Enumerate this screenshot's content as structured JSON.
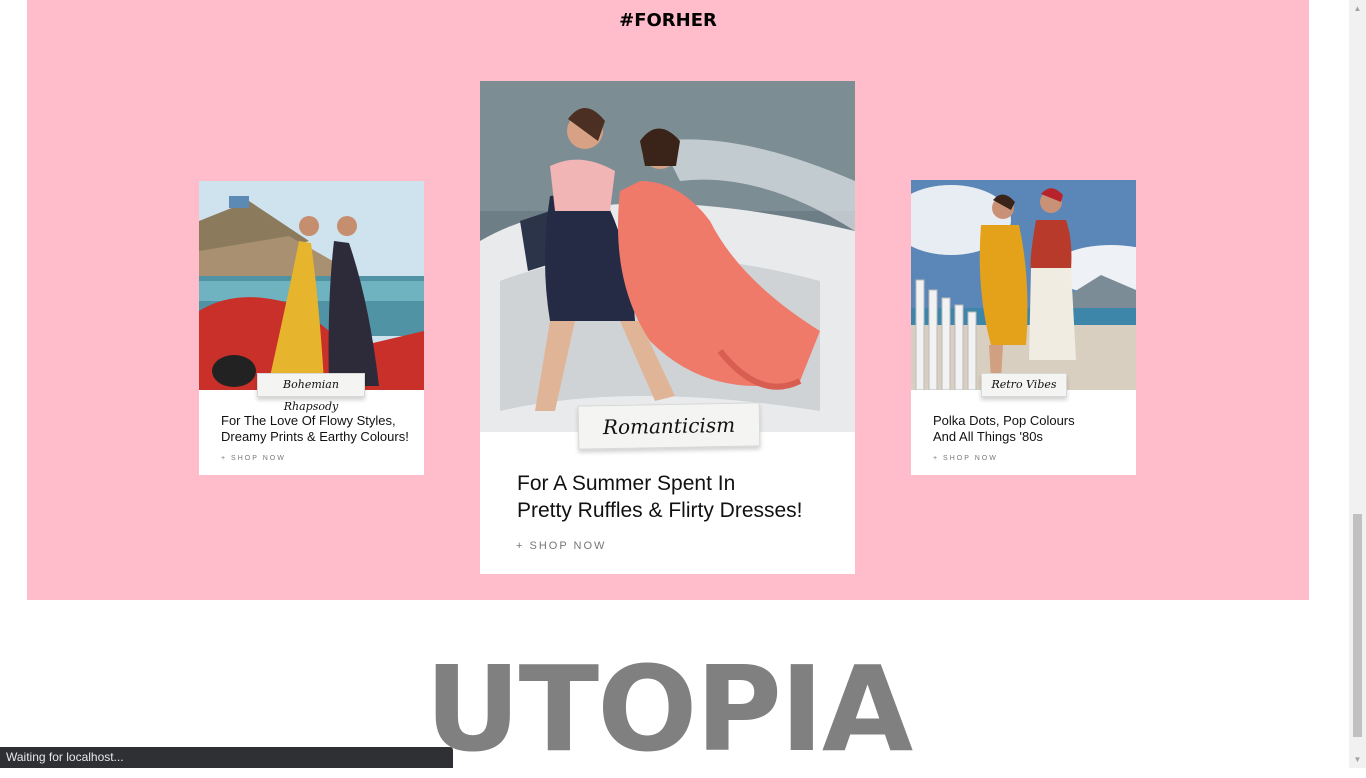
{
  "section": {
    "title": "#FORHER",
    "background": "#ffbdcb"
  },
  "cards": [
    {
      "tag": "Bohemian Rhapsody",
      "desc": [
        "For The Love Of Flowy Styles,",
        "Dreamy Prints & Earthy Colours!"
      ],
      "cta": "+ SHOP NOW"
    },
    {
      "tag": "Romanticism",
      "desc": [
        "For A Summer Spent In",
        "Pretty Ruffles & Flirty Dresses!"
      ],
      "cta": "+ SHOP NOW"
    },
    {
      "tag": "Retro Vibes",
      "desc": [
        "Polka Dots, Pop Colours",
        "And All Things '80s"
      ],
      "cta": "+ SHOP NOW"
    }
  ],
  "brand": {
    "text": "UTOPIA",
    "color": "#808080"
  },
  "status": {
    "text": "Waiting for localhost..."
  }
}
